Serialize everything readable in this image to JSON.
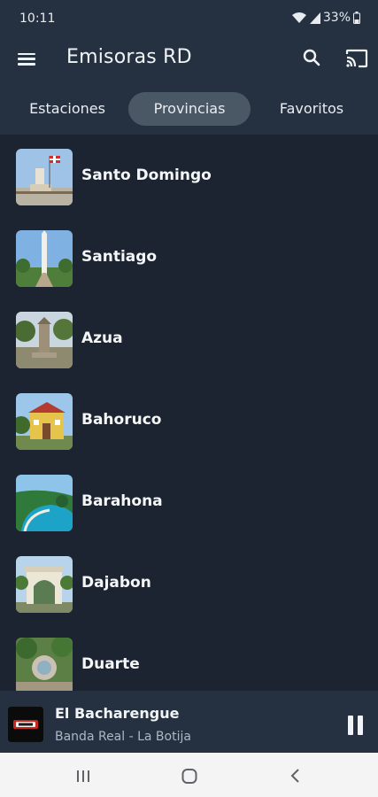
{
  "status_bar": {
    "time": "10:11",
    "battery": "33%"
  },
  "header": {
    "title": "Emisoras RD"
  },
  "tabs": [
    {
      "label": "Estaciones",
      "active": false
    },
    {
      "label": "Provincias",
      "active": true
    },
    {
      "label": "Favoritos",
      "active": false
    }
  ],
  "provinces": [
    {
      "name": "Santo Domingo"
    },
    {
      "name": "Santiago"
    },
    {
      "name": "Azua"
    },
    {
      "name": "Bahoruco"
    },
    {
      "name": "Barahona"
    },
    {
      "name": "Dajabon"
    },
    {
      "name": "Duarte"
    }
  ],
  "player": {
    "title": "El Bacharengue",
    "subtitle": "Banda Real - La Botija",
    "state": "playing"
  },
  "colors": {
    "background": "#1b2430",
    "bar": "#253140",
    "active_tab": "#4a5866",
    "text": "#f1f4f7",
    "subtext": "#aeb7c2",
    "nav_bar": "#f4f4f4"
  },
  "icons": {
    "menu": "menu-icon",
    "search": "search-icon",
    "cast": "cast-icon",
    "pause": "pause-icon",
    "nav_recents": "recents-icon",
    "nav_home": "home-icon",
    "nav_back": "back-icon"
  }
}
